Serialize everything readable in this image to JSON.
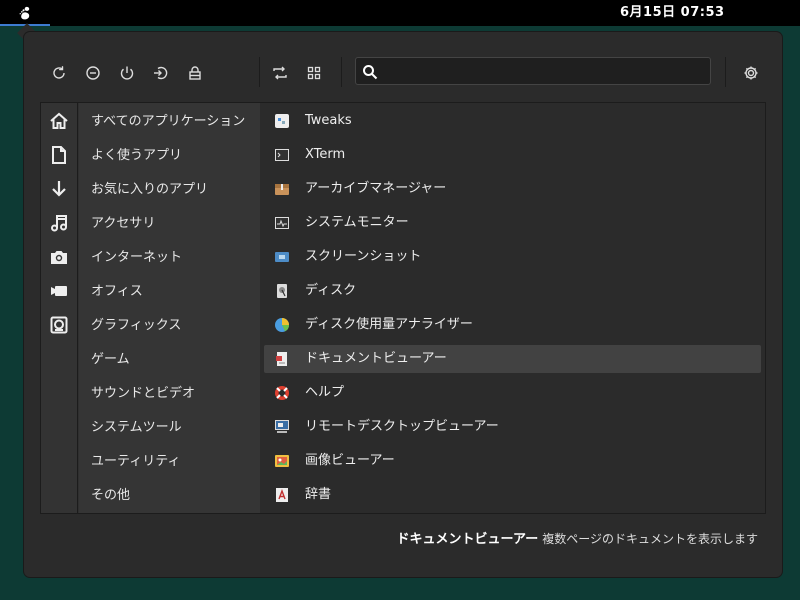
{
  "topbar": {
    "activities_icon": "gnome-foot-icon",
    "clock": "6月15日  07:53"
  },
  "toolbar": {
    "buttons": [
      {
        "name": "refresh-icon",
        "label": "再起動"
      },
      {
        "name": "suspend-icon",
        "label": "サスペンド"
      },
      {
        "name": "power-icon",
        "label": "電源オフ"
      },
      {
        "name": "logout-icon",
        "label": "ログアウト"
      },
      {
        "name": "lock-icon",
        "label": "ロック"
      }
    ],
    "view_buttons": [
      {
        "name": "switch-view-icon"
      },
      {
        "name": "grid-view-icon"
      }
    ],
    "search": {
      "placeholder": "",
      "value": ""
    },
    "settings_icon": "gear-icon"
  },
  "side_icons": [
    "home-icon",
    "document-icon",
    "download-icon",
    "music-icon",
    "camera-icon",
    "video-icon",
    "picture-icon"
  ],
  "categories": [
    "すべてのアプリケーション",
    "よく使うアプリ",
    "お気に入りのアプリ",
    "アクセサリ",
    "インターネット",
    "オフィス",
    "グラフィックス",
    "ゲーム",
    "サウンドとビデオ",
    "システムツール",
    "ユーティリティ",
    "その他"
  ],
  "apps": [
    {
      "label": "Tweaks",
      "icon": "tweaks-icon"
    },
    {
      "label": "XTerm",
      "icon": "terminal-icon"
    },
    {
      "label": "アーカイブマネージャー",
      "icon": "archive-icon"
    },
    {
      "label": "システムモニター",
      "icon": "system-monitor-icon"
    },
    {
      "label": "スクリーンショット",
      "icon": "screenshot-icon"
    },
    {
      "label": "ディスク",
      "icon": "disk-icon"
    },
    {
      "label": "ディスク使用量アナライザー",
      "icon": "disk-usage-icon"
    },
    {
      "label": "ドキュメントビューアー",
      "icon": "document-viewer-icon"
    },
    {
      "label": "ヘルプ",
      "icon": "help-icon"
    },
    {
      "label": "リモートデスクトップビューアー",
      "icon": "remote-desktop-icon"
    },
    {
      "label": "画像ビューアー",
      "icon": "image-viewer-icon"
    },
    {
      "label": "辞書",
      "icon": "dictionary-icon"
    }
  ],
  "selected_app_index": 7,
  "footer": {
    "title": "ドキュメントビューアー",
    "description": "複数ページのドキュメントを表示します"
  },
  "colors": {
    "desktop": "#0d3a34",
    "menu_bg": "#2b2b2b",
    "accent": "#3d7bd0",
    "selected_row": "#424242"
  }
}
